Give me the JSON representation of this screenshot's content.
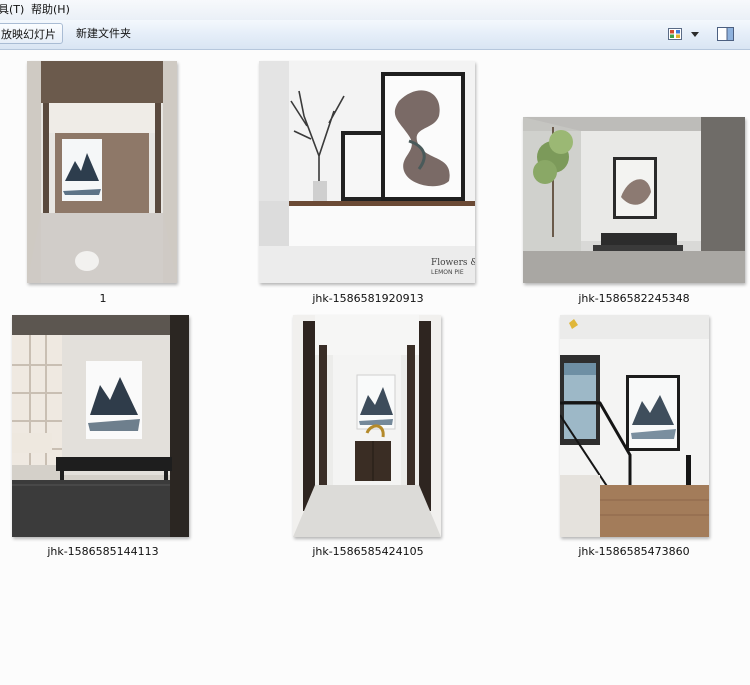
{
  "menubar": {
    "items": [
      {
        "label": "具(T)"
      },
      {
        "label": "帮助(H)"
      }
    ]
  },
  "toolbar": {
    "slideshow_label": "放映幻灯片",
    "new_folder_label": "新建文件夹",
    "view_icon": "thumbnail-view-icon",
    "view_dropdown_icon": "chevron-down-icon",
    "preview_pane_icon": "preview-pane-icon"
  },
  "files": [
    {
      "name": "1",
      "icon": "entrance-ink-painting-thumbnail"
    },
    {
      "name": "jhk-1586581920913",
      "icon": "branch-and-frames-thumbnail"
    },
    {
      "name": "jhk-1586582245348",
      "icon": "living-room-glass-thumbnail"
    },
    {
      "name": "jhk-1586585144113",
      "icon": "foyer-bench-thumbnail"
    },
    {
      "name": "jhk-1586585424105",
      "icon": "corridor-cabinet-thumbnail"
    },
    {
      "name": "jhk-1586585473860",
      "icon": "staircase-landing-thumbnail"
    }
  ],
  "thumbnail_watermarks": {
    "flowers": "Flowers &",
    "lemon": "LEMON PIE"
  },
  "colors": {
    "toolbar_top": "#f4f8fd",
    "toolbar_bottom": "#d9e5f3",
    "background": "#fcfcfc"
  }
}
